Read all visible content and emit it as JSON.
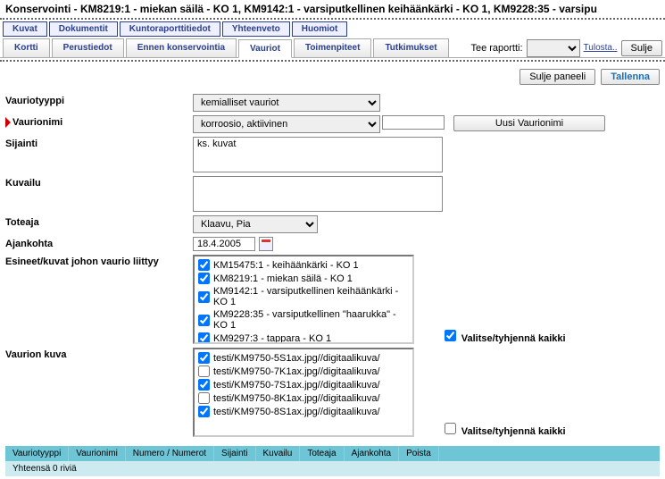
{
  "header": {
    "title": "Konservointi  - KM8219:1 - miekan säilä - KO 1, KM9142:1 - varsiputkellinen keihäänkärki - KO 1, KM9228:35 - varsipu"
  },
  "tabs_top": [
    "Kuvat",
    "Dokumentit",
    "Kuntoraporttitiedot",
    "Yhteenveto",
    "Huomiot"
  ],
  "tabs_main": [
    "Kortti",
    "Perustiedot",
    "Ennen konservointia",
    "Vauriot",
    "Toimenpiteet",
    "Tutkimukset"
  ],
  "active_main_tab": "Vauriot",
  "report_label": "Tee raportti:",
  "print_link": "Tulosta..",
  "close_btn": "Sulje",
  "panel_btns": {
    "close": "Sulje paneeli",
    "save": "Tallenna"
  },
  "form": {
    "vauriotyyppi_label": "Vauriotyyppi",
    "vauriotyyppi_value": "kemialliset vauriot",
    "vaurionimi_label": "Vaurionimi",
    "vaurionimi_value": "korroosio, aktiivinen",
    "vaurionimi_btn": "Uusi Vaurionimi",
    "sijainti_label": "Sijainti",
    "sijainti_value": "ks. kuvat",
    "kuvailu_label": "Kuvailu",
    "kuvailu_value": "",
    "toteaja_label": "Toteaja",
    "toteaja_value": "Klaavu, Pia",
    "ajankohta_label": "Ajankohta",
    "ajankohta_value": "18.4.2005",
    "esineet_label": "Esineet/kuvat johon vaurio liittyy",
    "esineet_items": [
      {
        "checked": true,
        "text": "KM15475:1 - keihäänkärki - KO 1"
      },
      {
        "checked": true,
        "text": "KM8219:1 - miekan säilä - KO 1"
      },
      {
        "checked": true,
        "text": "KM9142:1 - varsiputkellinen keihäänkärki - KO 1"
      },
      {
        "checked": true,
        "text": "KM9228:35 - varsiputkellinen \"haarukka\" - KO 1"
      },
      {
        "checked": true,
        "text": "KM9297:3 - tappara - KO 1"
      }
    ],
    "valitse1": "Valitse/tyhjennä kaikki",
    "vaurion_kuva_label": "Vaurion kuva",
    "kuva_items": [
      {
        "checked": true,
        "text": "testi/KM9750-5S1ax.jpg//digitaalikuva/"
      },
      {
        "checked": false,
        "text": "testi/KM9750-7K1ax.jpg//digitaalikuva/"
      },
      {
        "checked": true,
        "text": "testi/KM9750-7S1ax.jpg//digitaalikuva/"
      },
      {
        "checked": false,
        "text": "testi/KM9750-8K1ax.jpg//digitaalikuva/"
      },
      {
        "checked": true,
        "text": "testi/KM9750-8S1ax.jpg//digitaalikuva/"
      }
    ],
    "valitse2": "Valitse/tyhjennä kaikki"
  },
  "footer": {
    "cols": [
      "Vauriotyyppi",
      "Vaurionimi",
      "Numero / Numerot",
      "Sijainti",
      "Kuvailu",
      "Toteaja",
      "Ajankohta",
      "Poista"
    ],
    "total": "Yhteensä 0 riviä"
  }
}
